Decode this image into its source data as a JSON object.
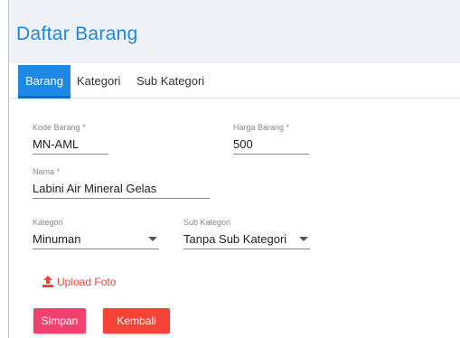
{
  "header": {
    "title": "Daftar Barang"
  },
  "tabs": [
    {
      "label": "Barang",
      "active": true
    },
    {
      "label": "Kategori",
      "active": false
    },
    {
      "label": "Sub Kategori",
      "active": false
    }
  ],
  "form": {
    "kode_barang": {
      "label": "Kode Barang *",
      "value": "MN-AML"
    },
    "harga_barang": {
      "label": "Harga Barang *",
      "value": "500"
    },
    "nama": {
      "label": "Nama *",
      "value": "Labini Air Mineral Gelas"
    },
    "kategori": {
      "label": "Kategori",
      "selected": "Minuman"
    },
    "sub_kategori": {
      "label": "Sub Kategori",
      "selected": "Tanpa Sub Kategori"
    }
  },
  "upload_label": "Upload Foto",
  "buttons": {
    "save_label": "Simpan",
    "back_label": "Kembali"
  },
  "colors": {
    "primary": "#1e88e5",
    "danger": "#f44336",
    "accent_pink": "#f1416f"
  },
  "icons": {
    "upload": "upload-icon",
    "dropdown": "chevron-down-icon"
  }
}
